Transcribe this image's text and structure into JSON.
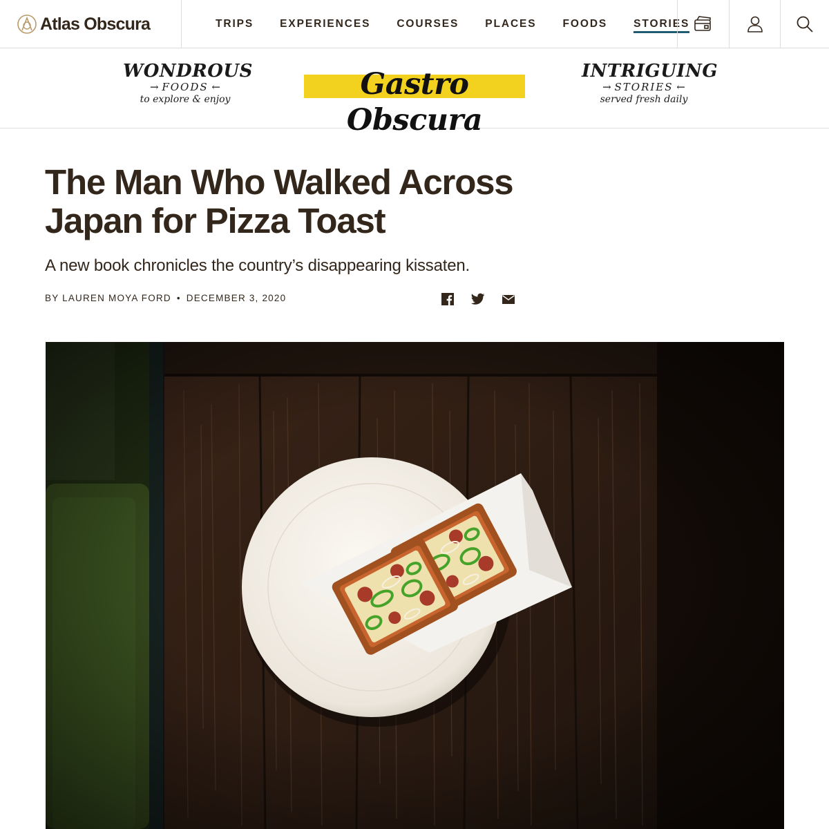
{
  "site": {
    "logo_text": "Atlas Obscura"
  },
  "nav": {
    "links": [
      {
        "label": "TRIPS"
      },
      {
        "label": "EXPERIENCES"
      },
      {
        "label": "COURSES"
      },
      {
        "label": "PLACES"
      },
      {
        "label": "FOODS"
      },
      {
        "label": "STORIES",
        "active": true
      }
    ],
    "icons": [
      "membership-icon",
      "account-icon",
      "search-icon"
    ]
  },
  "banner": {
    "left": {
      "line1": "WONDROUS",
      "line2": "FOODS",
      "line3": "to explore & enjoy"
    },
    "center": "Gastro Obscura",
    "right": {
      "line1": "INTRIGUING",
      "line2": "STORIES",
      "line3": "served fresh daily"
    },
    "accent_color": "#f3d21f"
  },
  "article": {
    "title": "The Man Who Walked Across Japan for Pizza Toast",
    "subtitle": "A new book chronicles the country’s disappearing kissaten.",
    "byline": {
      "author": "BY LAUREN MOYA FORD",
      "separator": "•",
      "date": "DECEMBER 3, 2020"
    },
    "share_icons": [
      "facebook-icon",
      "twitter-icon",
      "email-icon"
    ]
  },
  "colors": {
    "text": "#33271c",
    "active_underline": "#1f5b73",
    "border": "#dcdcdc"
  }
}
